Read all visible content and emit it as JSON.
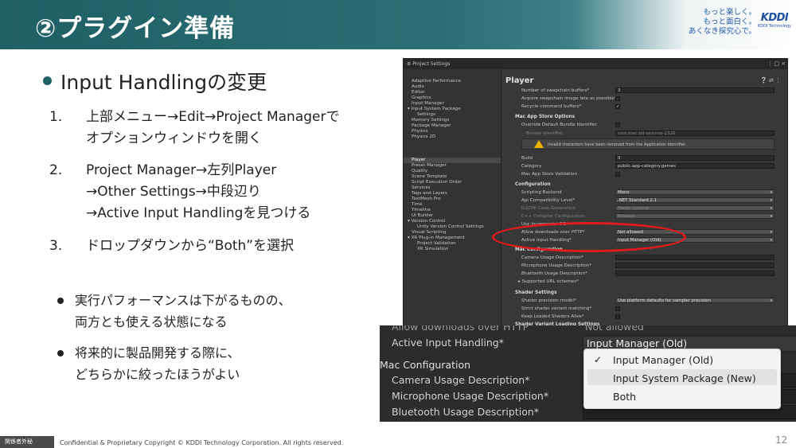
{
  "header": {
    "title": "②プラグイン準備",
    "tagline": [
      "もっと楽しく。",
      "もっと面白く。",
      "あくなき探究心で。"
    ],
    "logo_mark": "KDDI",
    "logo_sub": "KDDI Technology"
  },
  "content": {
    "section_title": "Input Handlingの変更",
    "steps": [
      {
        "num": "1.",
        "lines": [
          "上部メニュー→Edit→Project Managerで",
          "オプションウィンドウを開く"
        ]
      },
      {
        "num": "2.",
        "lines": [
          "Project Manager→左列Player",
          "→Other Settings→中段辺り",
          "→Active Input Handlingを見つける"
        ]
      },
      {
        "num": "3.",
        "lines": [
          "ドロップダウンから“Both”を選択"
        ]
      }
    ],
    "notes": [
      {
        "lines": [
          "実行パフォーマンスは下がるものの、",
          "両方とも使える状態になる"
        ]
      },
      {
        "lines": [
          "将来的に製品開発する際に、",
          "どちらかに絞ったほうがよい"
        ]
      }
    ]
  },
  "unity": {
    "window_title": "Project Settings",
    "sidebar": [
      "Adaptive Performance",
      "Audio",
      "Editor",
      "Graphics",
      "Input Manager",
      "Input System Package",
      "Settings",
      "Memory Settings",
      "Package Manager",
      "Physics",
      "Physics 2D",
      "Player",
      "Preset Manager",
      "Quality",
      "Scene Template",
      "Script Execution Order",
      "Services",
      "Tags and Layers",
      "TextMesh Pro",
      "Time",
      "Timeline",
      "UI Builder",
      "Version Control",
      "Unity Version Control Settings",
      "Visual Scripting",
      "XR Plug-in Management",
      "Project Validation",
      "XR Simulation"
    ],
    "panel_title": "Player",
    "rows": {
      "swapchain_buffers": "Number of swapchain buffers*",
      "swapchain_buffers_value": "3",
      "acquire_swapchain": "Acquire swapchain image late as possible*",
      "recycle_cmd": "Recycle command buffers*",
      "mac_app_store": "Mac App Store Options",
      "override_bundle": "Override Default Bundle Identifier",
      "bundle_identifier": "Bundle Identifier",
      "bundle_identifier_value": "com.ktec.bd-seminar-2326",
      "warning": "Invalid characters have been removed from the Application Identifier.",
      "build": "Build",
      "build_value": "0",
      "category": "Category",
      "category_value": "public.app-category.games",
      "store_validation": "Mac App Store Validation",
      "configuration": "Configuration",
      "scripting_backend": "Scripting Backend",
      "scripting_backend_value": "Mono",
      "api_level": "Api Compatibility Level*",
      "api_level_value": ".NET Standard 2.1",
      "il2cpp_gen": "IL2CPP Code Generation",
      "il2cpp_gen_value": "Faster runtime",
      "cpp_config": "C++ Compiler Configuration",
      "cpp_config_value": "Release",
      "use_incremental": "Use incremental GC",
      "allow_downloads": "Allow downloads over HTTP*",
      "allow_downloads_value": "Not allowed",
      "active_input": "Active Input Handling*",
      "active_input_value": "Input Manager (Old)",
      "mac_config": "Mac Configuration",
      "camera_usage": "Camera Usage Description*",
      "mic_usage": "Microphone Usage Description*",
      "bt_usage": "Bluetooth Usage Description*",
      "url_schemes": "Supported URL schemes*",
      "shader_settings": "Shader Settings",
      "shader_precision": "Shader precision model*",
      "shader_precision_value": "Use platform defaults for sampler precision",
      "strict_shader": "Strict shader variant matching*",
      "keep_shaders": "Keep Loaded Shaders Alive*",
      "shader_loading": "Shader Variant Loading Settings"
    }
  },
  "zoom": {
    "allow_downloads": "Allow downloads over HTTP",
    "not_allowed": "Not allowed",
    "active_input": "Active Input Handling*",
    "active_input_value": "Input Manager (Old)",
    "mac_config": "Mac Configuration",
    "camera_usage": "Camera Usage Description*",
    "mic_usage": "Microphone Usage Description*",
    "bt_usage": "Bluetooth Usage Description*",
    "options": [
      "Input Manager (Old)",
      "Input System Package (New)",
      "Both"
    ],
    "checkmark": "✓"
  },
  "footer": {
    "badge": "関係者外秘",
    "text": "Confidential & Proprietary  Copyright © KDDI Technology Corporation. All rights reserved.",
    "page": "12"
  }
}
